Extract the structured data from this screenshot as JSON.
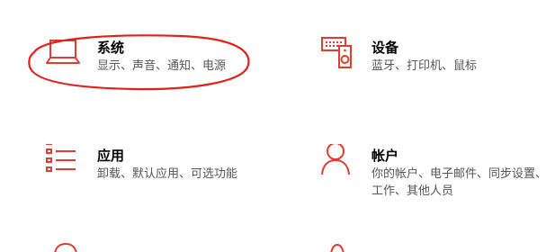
{
  "settings": {
    "accent_color": "#e03c31",
    "annotation_color": "#e0201a",
    "tiles": [
      {
        "id": "system",
        "title": "系统",
        "desc": "显示、声音、通知、电源",
        "icon": "laptop-icon"
      },
      {
        "id": "devices",
        "title": "设备",
        "desc": "蓝牙、打印机、鼠标",
        "icon": "devices-icon"
      },
      {
        "id": "apps",
        "title": "应用",
        "desc": "卸载、默认应用、可选功能",
        "icon": "apps-list-icon"
      },
      {
        "id": "accounts",
        "title": "帐户",
        "desc": "你的帐户、电子邮件、同步设置、工作、其他人员",
        "icon": "person-icon"
      }
    ]
  }
}
